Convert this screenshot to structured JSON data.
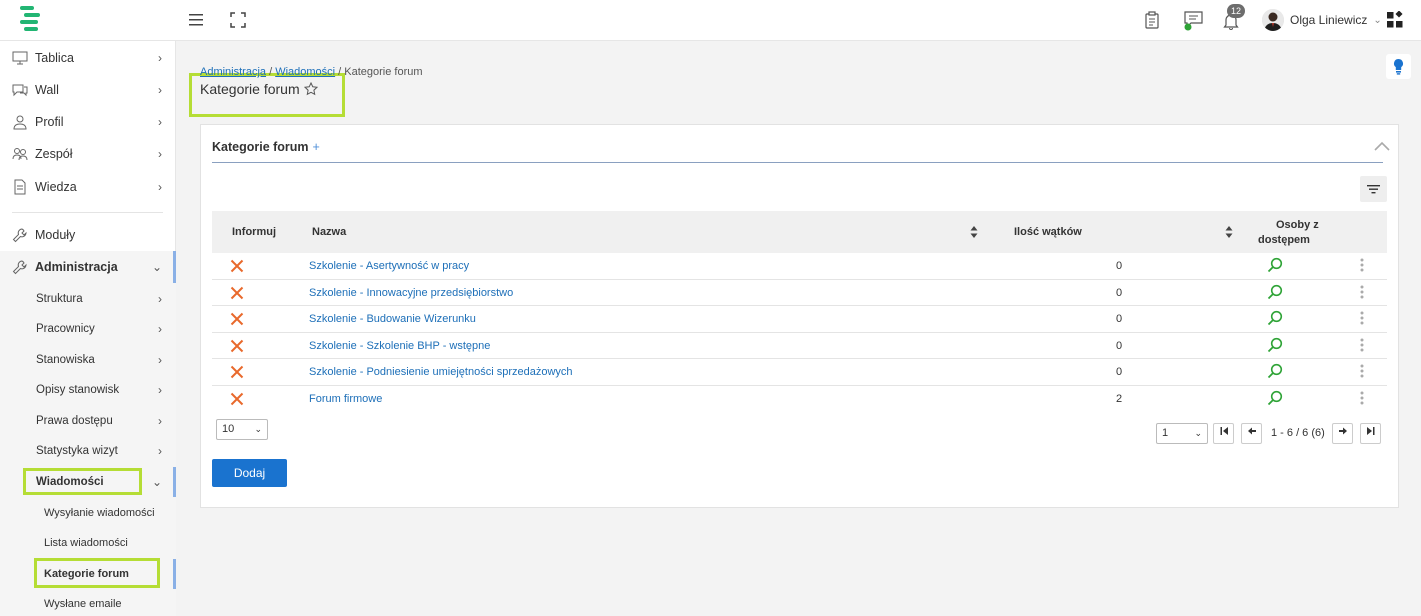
{
  "header": {
    "notification_count": "12",
    "user_name": "Olga Liniewicz"
  },
  "sidebar": {
    "items": [
      {
        "label": "Tablica",
        "icon": "monitor-icon"
      },
      {
        "label": "Wall",
        "icon": "chat-icon"
      },
      {
        "label": "Profil",
        "icon": "user-icon"
      },
      {
        "label": "Zespół",
        "icon": "team-icon"
      },
      {
        "label": "Wiedza",
        "icon": "document-icon"
      }
    ],
    "modules": {
      "label": "Moduły",
      "icon": "wrench-icon"
    },
    "admin": {
      "label": "Administracja",
      "icon": "wrench-icon"
    },
    "admin_items": [
      {
        "label": "Struktura"
      },
      {
        "label": "Pracownicy"
      },
      {
        "label": "Stanowiska"
      },
      {
        "label": "Opisy stanowisk"
      },
      {
        "label": "Prawa dostępu"
      },
      {
        "label": "Statystyka wizyt"
      }
    ],
    "messages": {
      "label": "Wiadomości"
    },
    "message_items": [
      {
        "label": "Wysyłanie wiadomości"
      },
      {
        "label": "Lista wiadomości"
      },
      {
        "label": "Kategorie forum"
      },
      {
        "label": "Wysłane emaile"
      }
    ]
  },
  "breadcrumb": {
    "part1": "Administracja",
    "sep1": " / ",
    "part2": "Wiadomości",
    "sep2": " / ",
    "current": "Kategorie forum"
  },
  "page_title": "Kategorie forum",
  "card": {
    "title": "Kategorie forum",
    "plus": "+"
  },
  "table": {
    "headers": {
      "inform": "Informuj",
      "name": "Nazwa",
      "threads": "Ilość wątków",
      "access_line1": "Osoby z",
      "access_line2": "dostępem"
    },
    "rows": [
      {
        "name": "Szkolenie - Asertywność w pracy",
        "threads": "0"
      },
      {
        "name": "Szkolenie - Innowacyjne przedsiębiorstwo",
        "threads": "0"
      },
      {
        "name": "Szkolenie - Budowanie Wizerunku",
        "threads": "0"
      },
      {
        "name": "Szkolenie - Szkolenie BHP - wstępne",
        "threads": "0"
      },
      {
        "name": "Szkolenie - Podniesienie umiejętności sprzedażowych",
        "threads": "0"
      },
      {
        "name": "Forum firmowe",
        "threads": "2"
      }
    ]
  },
  "pagination": {
    "per_page": "10",
    "page": "1",
    "first": "⏮",
    "prev": "←",
    "next": "→",
    "last": "⏭",
    "info": "1 - 6 / 6 (6)"
  },
  "add_button": "Dodaj",
  "colors": {
    "accent": "#1a73cf",
    "link": "#1d6fb8",
    "highlight": "#b5dd35",
    "delete": "#e8692c",
    "search": "#2ea336",
    "logo": "#22b573"
  }
}
